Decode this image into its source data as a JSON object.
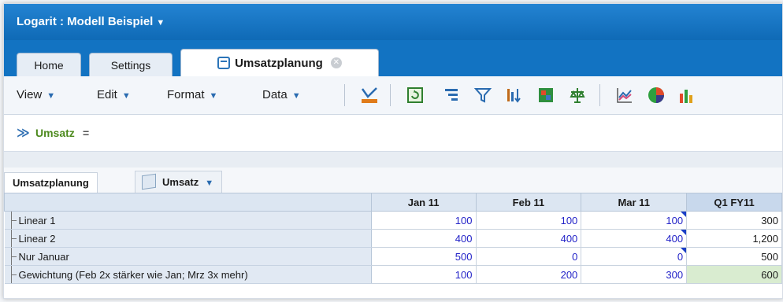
{
  "window": {
    "title": "Logarit : Modell Beispiel",
    "caret": "▼"
  },
  "tabs": [
    {
      "label": "Home"
    },
    {
      "label": "Settings"
    },
    {
      "label": "Umsatzplanung",
      "active": true,
      "close": "✕"
    }
  ],
  "menu": {
    "items": [
      {
        "label": "View"
      },
      {
        "label": "Edit"
      },
      {
        "label": "Format"
      },
      {
        "label": "Data"
      }
    ],
    "caret": "▼"
  },
  "toolbar_icons": [
    "pivot-icon",
    "refresh-icon",
    "list-indent-icon",
    "filter-icon",
    "sort-icon",
    "chart-map-icon",
    "balance-icon",
    "line-chart-icon",
    "pie-chart-icon",
    "bar-chart-icon"
  ],
  "formula": {
    "chevron": "≫",
    "text": "Umsatz",
    "eq": "="
  },
  "sheet": {
    "name": "Umsatzplanung",
    "cube": "Umsatz",
    "caret": "▼"
  },
  "grid": {
    "columns": [
      "Jan 11",
      "Feb 11",
      "Mar 11",
      "Q1 FY11"
    ],
    "rows": [
      {
        "label": "Linear 1",
        "values": [
          "100",
          "100",
          "100"
        ],
        "total": "300"
      },
      {
        "label": "Linear 2",
        "values": [
          "400",
          "400",
          "400"
        ],
        "total": "1,200"
      },
      {
        "label": "Nur Januar",
        "values": [
          "500",
          "0",
          "0"
        ],
        "total": "500"
      },
      {
        "label": "Gewichtung (Feb 2x stärker wie Jan; Mrz 3x mehr)",
        "values": [
          "100",
          "200",
          "300"
        ],
        "total": "600"
      }
    ]
  },
  "colors": {
    "titlebar": "#1879c8",
    "value_blue": "#2323c8",
    "formula_green": "#4d8a1e",
    "highlight_green": "#d9ecd0"
  }
}
